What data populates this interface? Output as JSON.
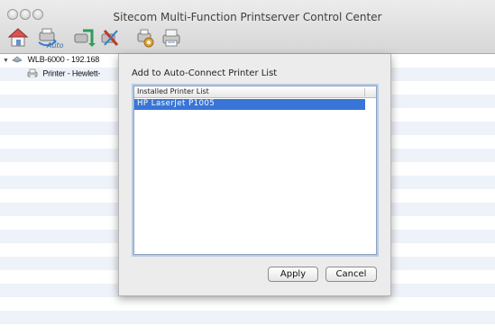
{
  "window": {
    "title": "Sitecom Multi-Function Printserver Control Center"
  },
  "toolbar": {
    "icons": [
      "home-icon",
      "auto-connect-icon",
      "connect-icon",
      "disconnect-icon",
      "settings-icon",
      "printer-tools-icon"
    ],
    "auto_label": "Auto"
  },
  "tree": {
    "server": "WLB-6000 - 192.168",
    "printer": "Printer - Hewlett-"
  },
  "dialog": {
    "title": "Add to Auto-Connect Printer List",
    "list_header": "Installed Printer List",
    "items": [
      "HP LaserJet P1005"
    ],
    "apply_label": "Apply",
    "cancel_label": "Cancel"
  },
  "colors": {
    "selection": "#3875d7",
    "row_alt": "#eef2f9",
    "focus_ring": "#b8cbe6"
  }
}
